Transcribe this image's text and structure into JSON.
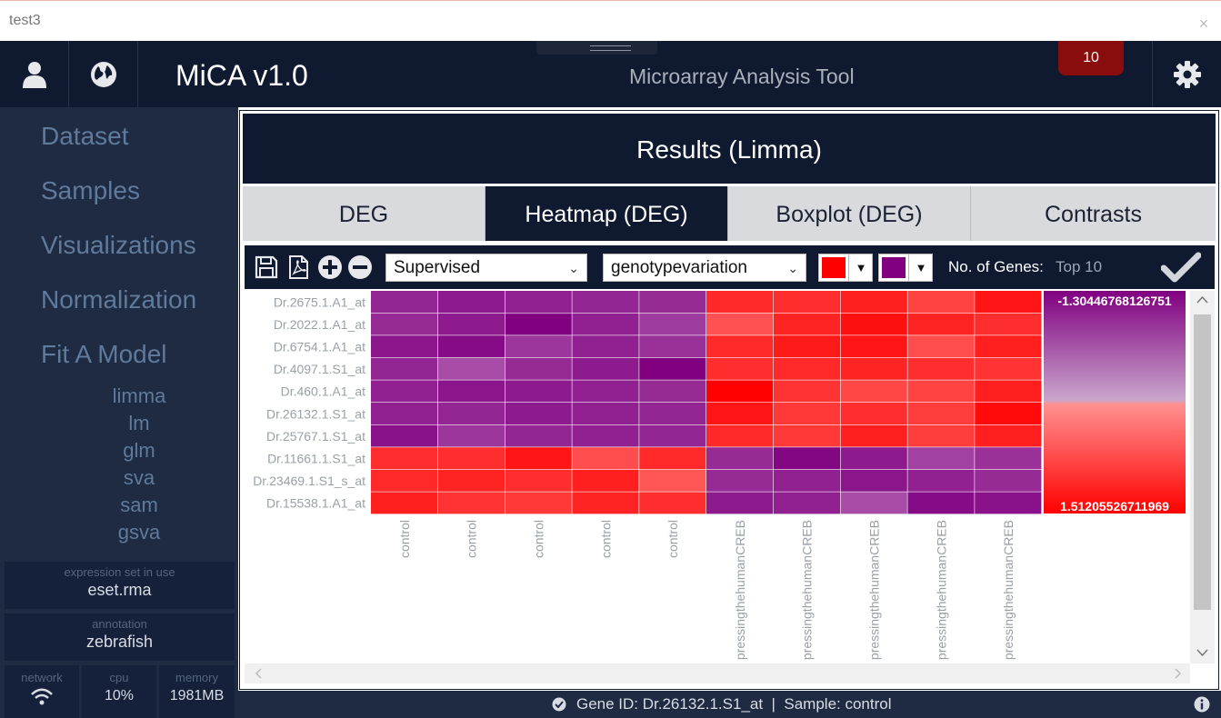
{
  "window": {
    "title": "test3",
    "close_glyph": "×"
  },
  "header": {
    "app_name": "MiCA v1.0",
    "subtitle": "Microarray Analysis Tool",
    "notification_count": "10"
  },
  "sidebar": {
    "nav": [
      "Dataset",
      "Samples",
      "Visualizations",
      "Normalization",
      "Fit A Model"
    ],
    "sub_items": [
      "limma",
      "lm",
      "glm",
      "sva",
      "sam",
      "gsva"
    ],
    "expression_set": {
      "label": "expression set in use",
      "value": "eset.rma"
    },
    "annotation": {
      "label": "annotation",
      "value": "zebrafish"
    },
    "stats": {
      "network": {
        "label": "network",
        "icon": "wifi-icon"
      },
      "cpu": {
        "label": "cpu",
        "value": "10%"
      },
      "memory": {
        "label": "memory",
        "value": "1981MB"
      }
    }
  },
  "main": {
    "title": "Results (Limma)",
    "tabs": [
      {
        "label": "DEG",
        "active": false
      },
      {
        "label": "Heatmap (DEG)",
        "active": true
      },
      {
        "label": "Boxplot (DEG)",
        "active": false
      },
      {
        "label": "Contrasts",
        "active": false
      }
    ],
    "toolbar": {
      "clustering": "Supervised",
      "grouping": "genotypevariation",
      "low_color": "#ff0000",
      "high_color": "#800080",
      "genes_label": "No. of Genes:",
      "genes_value": "Top 10"
    }
  },
  "chart_data": {
    "type": "heatmap",
    "rows": [
      "Dr.2675.1.A1_at",
      "Dr.2022.1.A1_at",
      "Dr.6754.1.A1_at",
      "Dr.4097.1.S1_at",
      "Dr.460.1.A1_at",
      "Dr.26132.1.S1_at",
      "Dr.25767.1.S1_at",
      "Dr.11661.1.S1_at",
      "Dr.23469.1.S1_s_at",
      "Dr.15538.1.A1_at"
    ],
    "columns": [
      "control",
      "control",
      "control",
      "control",
      "control",
      "pressingthehumanCREB",
      "pressingthehumanCREB",
      "pressingthehumanCREB",
      "pressingthehumanCREB",
      "pressingthehumanCREB"
    ],
    "legend_max": "-1.30446768126751",
    "legend_min": "1.51205526711969",
    "scale_max": -1.30446768126751,
    "scale_min": 1.51205526711969,
    "values": [
      [
        -0.95,
        -1.05,
        -1.0,
        -0.95,
        -0.9,
        1.1,
        1.05,
        1.2,
        0.85,
        1.3
      ],
      [
        -0.9,
        -1.05,
        -1.3,
        -1.0,
        -0.75,
        0.7,
        1.15,
        1.35,
        1.15,
        1.05
      ],
      [
        -1.1,
        -1.2,
        -0.8,
        -1.0,
        -0.85,
        1.1,
        1.25,
        1.3,
        0.75,
        1.2
      ],
      [
        -0.95,
        -0.6,
        -0.9,
        -1.05,
        -1.3,
        1.05,
        1.1,
        1.15,
        1.05,
        1.0
      ],
      [
        -1.0,
        -1.1,
        -1.05,
        -1.0,
        -0.9,
        1.5,
        1.0,
        0.8,
        0.85,
        1.2
      ],
      [
        -1.0,
        -0.95,
        -1.05,
        -1.0,
        -0.95,
        1.3,
        0.95,
        1.05,
        0.9,
        1.4
      ],
      [
        -1.15,
        -0.8,
        -0.95,
        -1.0,
        -0.95,
        1.1,
        0.95,
        1.2,
        0.9,
        1.2
      ],
      [
        1.05,
        1.05,
        1.3,
        0.75,
        1.1,
        -0.9,
        -1.25,
        -1.05,
        -0.7,
        -0.85
      ],
      [
        1.1,
        1.15,
        1.05,
        1.2,
        0.65,
        -0.9,
        -1.0,
        -1.1,
        -1.0,
        -0.9
      ],
      [
        1.2,
        1.0,
        0.95,
        1.15,
        1.05,
        -1.05,
        -1.0,
        -0.6,
        -1.2,
        -1.15
      ]
    ]
  },
  "statusbar": {
    "text": "Gene ID: Dr.26132.1.S1_at  |  Sample: control"
  }
}
